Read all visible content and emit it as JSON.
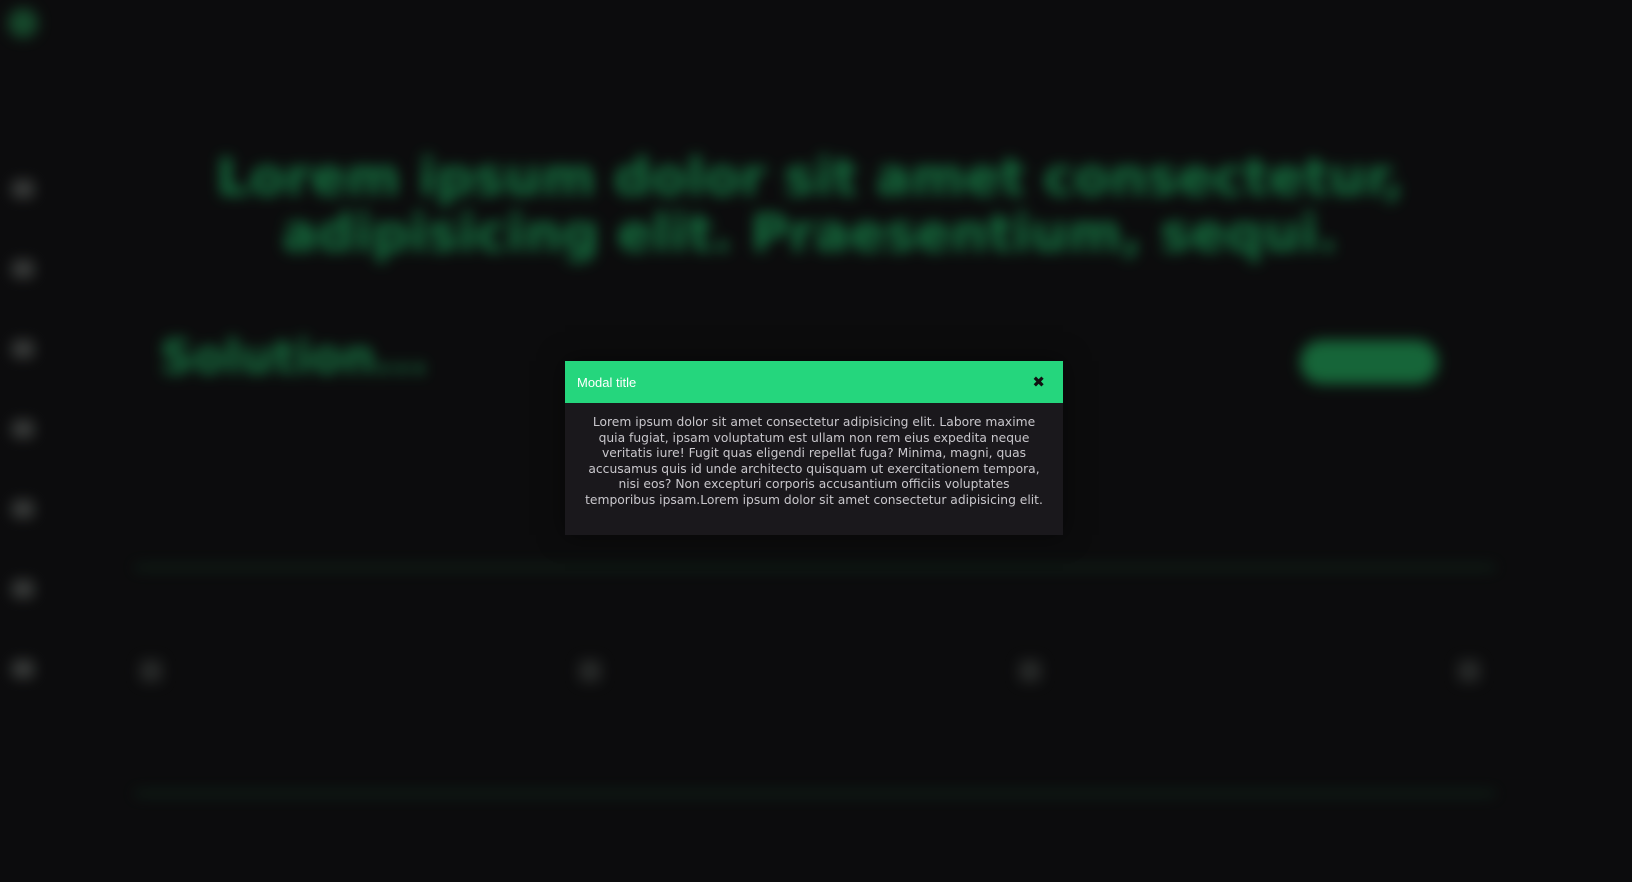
{
  "background_page": {
    "logo_text": "",
    "nav_items": [
      "",
      "",
      "",
      ""
    ],
    "headline_line1": "Lorem ipsum dolor sit amet consectetur,",
    "headline_line2": "adipisicing elit. Praesentium, sequi.",
    "section_title": "Solution...",
    "filters": [
      "",
      "",
      "",
      "",
      "",
      ""
    ],
    "cta_label": "",
    "paragraph": "",
    "features": [
      "",
      "",
      "",
      ""
    ],
    "colors": {
      "accent": "#22c46c",
      "background": "#0c0c0d"
    }
  },
  "modal": {
    "title": "Modal title",
    "close_icon": "close-icon",
    "body": "Lorem ipsum dolor sit amet consectetur adipisicing elit. Labore maxime quia fugiat, ipsam voluptatum est ullam non rem eius expedita neque veritatis iure! Fugit quas eligendi repellat fuga? Minima, magni, quas accusamus quis id unde architecto quisquam ut exercitationem tempora, nisi eos? Non excepturi corporis accusantium officiis voluptates temporibus ipsam.Lorem ipsum dolor sit amet consectetur adipisicing elit.",
    "colors": {
      "header": "#25d67d",
      "body_bg": "#1a181c",
      "body_text": "#c9c7cc"
    }
  }
}
